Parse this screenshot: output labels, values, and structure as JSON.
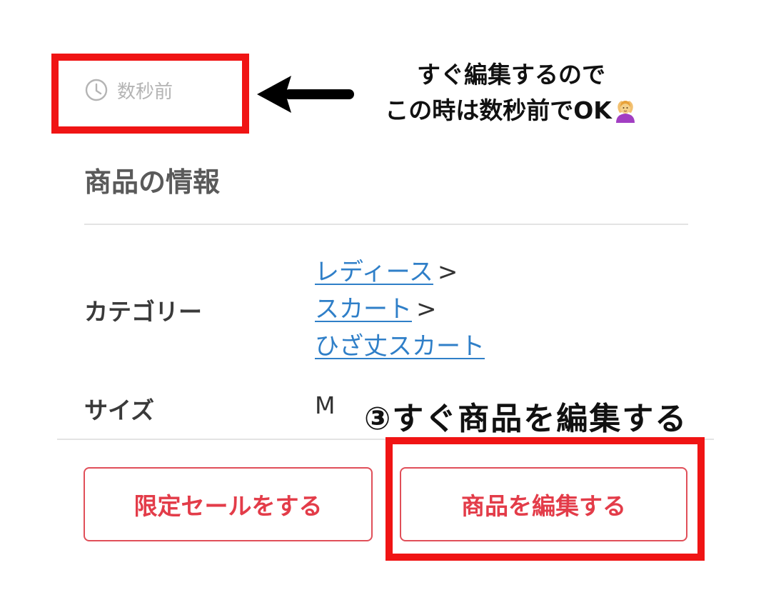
{
  "item": {
    "timestamp": "数秒前",
    "section_title": "商品の情報",
    "category_label": "カテゴリー",
    "category_path": [
      "レディース",
      "スカート",
      "ひざ丈スカート"
    ],
    "separator": ">",
    "size_label": "サイズ",
    "size_value": "M"
  },
  "buttons": {
    "limited_sale": "限定セールをする",
    "edit_item": "商品を編集する"
  },
  "annotations": {
    "note_line1": "すぐ編集するので",
    "note_line2": "この時は数秒前でOK",
    "note_emoji": "person-gesturing-ok-icon",
    "step": "③すぐ商品を編集する"
  },
  "colors": {
    "accent": "#e33c49",
    "link": "#2f7fc8",
    "highlight": "#f01414"
  }
}
